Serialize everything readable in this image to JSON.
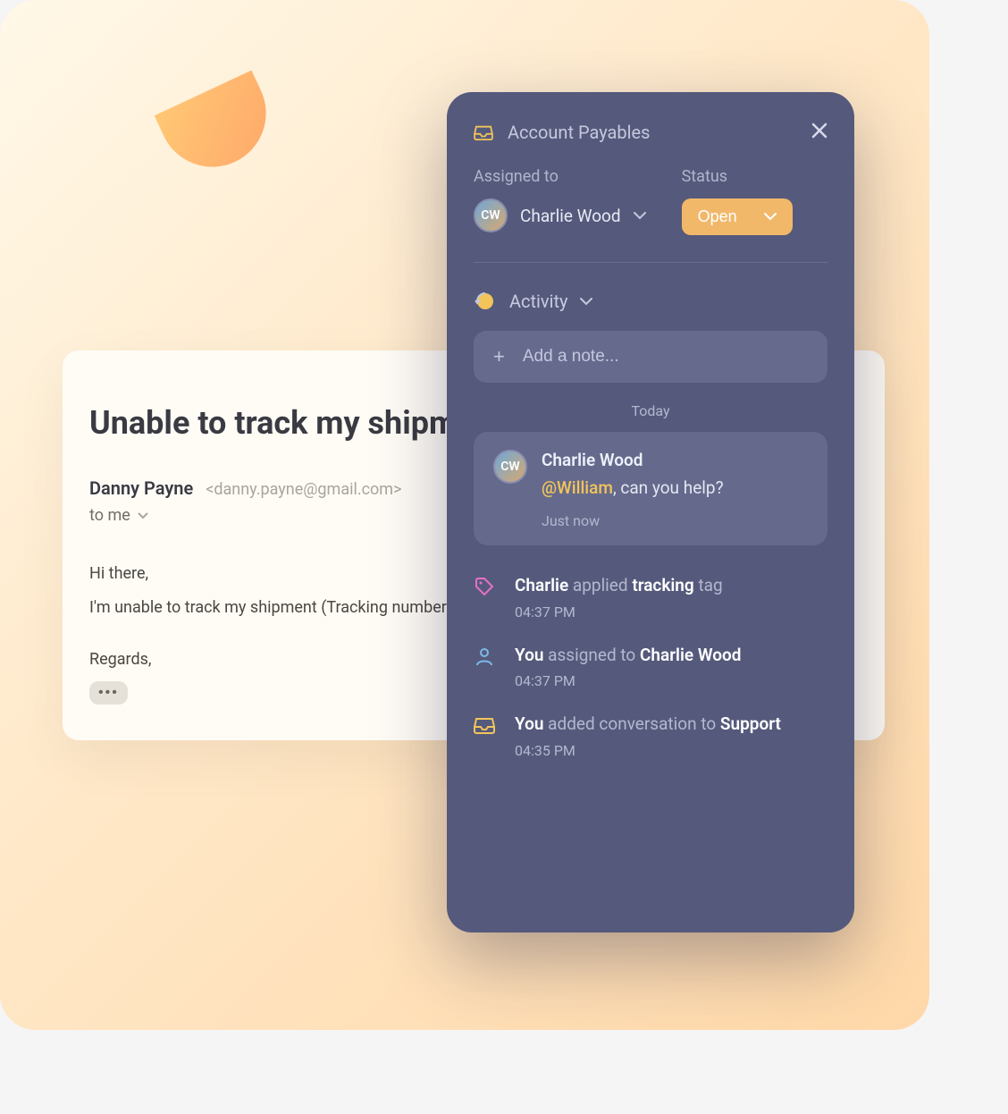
{
  "email": {
    "subject": "Unable to track my shipment",
    "from_name": "Danny Payne",
    "from_address": "<danny.payne@gmail.com>",
    "to_label": "to me",
    "body_line1": "Hi there,",
    "body_line2": "I'm unable to track my shipment (Tracking number",
    "signoff": "Regards,"
  },
  "panel": {
    "title": "Account Payables",
    "assigned_label": "Assigned to",
    "assignee_name": "Charlie Wood",
    "assignee_initials": "CW",
    "status_label": "Status",
    "status_value": "Open",
    "activity_label": "Activity",
    "add_note_placeholder": "Add a note...",
    "today_label": "Today",
    "note": {
      "author": "Charlie Wood",
      "author_initials": "CW",
      "mention": "@William",
      "text_after": ", can you help?",
      "time": "Just now"
    },
    "events": [
      {
        "icon": "tag",
        "actor": "Charlie",
        "middle": "applied",
        "target": "tracking",
        "suffix": "tag",
        "time": "04:37 PM"
      },
      {
        "icon": "person",
        "actor": "You",
        "middle": "assigned to",
        "target": "Charlie Wood",
        "suffix": "",
        "time": "04:37 PM"
      },
      {
        "icon": "inbox",
        "actor": "You",
        "middle": "added conversation to",
        "target": "Support",
        "suffix": "",
        "time": "04:35 PM"
      }
    ]
  }
}
